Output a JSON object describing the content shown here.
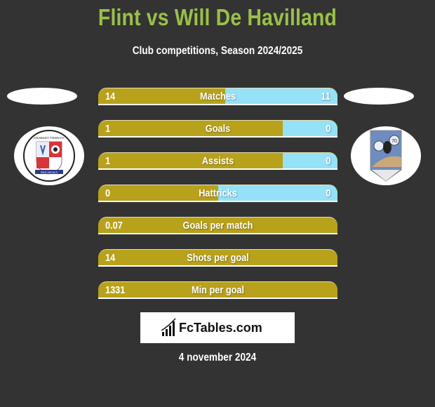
{
  "header": {
    "title": "Flint vs Will De Havilland",
    "subtitle": "Club competitions, Season 2024/2025"
  },
  "teams": {
    "left": {
      "name": "Crawley Town FC",
      "logo_text_top": "CRAWLEY TOWN FC",
      "logo_text_bottom": "RED DEVILS"
    },
    "right": {
      "name": "Will De Havilland",
      "logo_text_top": "70"
    }
  },
  "colors": {
    "left_bar": "#b8a11b",
    "right_bar": "#95e1f8",
    "title": "#9ac048",
    "background": "#333333"
  },
  "stats": [
    {
      "label": "Matches",
      "left": "14",
      "right": "11",
      "right_fraction": 0.47
    },
    {
      "label": "Goals",
      "left": "1",
      "right": "0",
      "right_fraction": 0.23
    },
    {
      "label": "Assists",
      "left": "1",
      "right": "0",
      "right_fraction": 0.23
    },
    {
      "label": "Hattricks",
      "left": "0",
      "right": "0",
      "right_fraction": 0.5
    },
    {
      "label": "Goals per match",
      "left": "0.07",
      "right": "",
      "right_fraction": 0
    },
    {
      "label": "Shots per goal",
      "left": "14",
      "right": "",
      "right_fraction": 0
    },
    {
      "label": "Min per goal",
      "left": "1331",
      "right": "",
      "right_fraction": 0
    }
  ],
  "brand": {
    "name": "FcTables.com",
    "icon": "bar-chart-icon"
  },
  "date": "4 november 2024"
}
